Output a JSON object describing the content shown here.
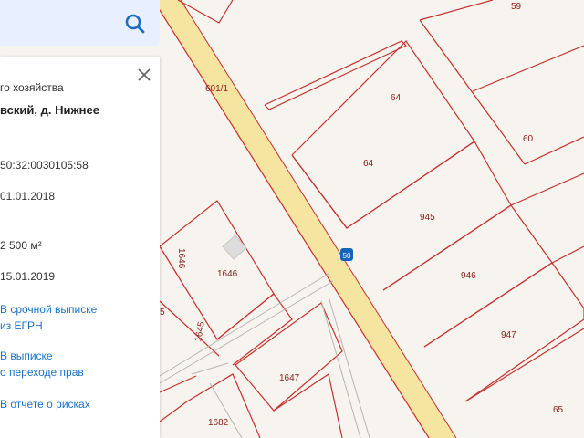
{
  "search": {
    "placeholder": ""
  },
  "panel": {
    "line1": "го хозяйства",
    "line2": "вский, д. Нижнее",
    "cadastral_number": "50:32:0030105:58",
    "date1": "01.01.2018",
    "area": "2 500 м²",
    "date2": "15.01.2019",
    "link1": [
      "В срочной выписке",
      "из ЕГРН"
    ],
    "link2": [
      "В выписке",
      "о переходе прав"
    ],
    "link3": "В отчете о рисках"
  },
  "map": {
    "plot_labels": [
      "59",
      "601/1",
      "64",
      "64",
      "60",
      "945",
      "946",
      "947",
      "65",
      "1646",
      "1646",
      "1645",
      "1647",
      "1682",
      "5"
    ],
    "road_marker": "50"
  },
  "colors": {
    "road": "#f7e6a6",
    "parcel_line": "#c8302e",
    "link": "#1a73c9",
    "search_bg": "#e8f0ff"
  }
}
